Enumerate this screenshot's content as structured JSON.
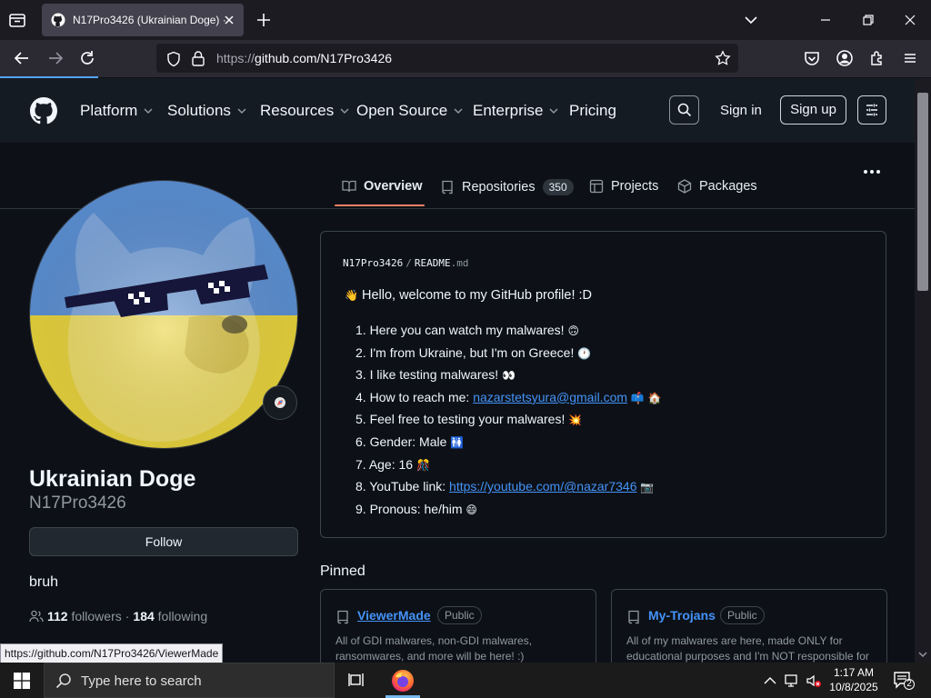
{
  "browser": {
    "tab_title": "N17Pro3426 (Ukrainian Doge) ·",
    "url_protocol": "https://",
    "url_rest": "github.com/N17Pro3426",
    "status_url": "https://github.com/N17Pro3426/ViewerMade"
  },
  "github_header": {
    "nav": [
      {
        "label": "Platform",
        "has_menu": true
      },
      {
        "label": "Solutions",
        "has_menu": true
      },
      {
        "label": "Resources",
        "has_menu": true
      },
      {
        "label": "Open Source",
        "has_menu": true
      },
      {
        "label": "Enterprise",
        "has_menu": true
      },
      {
        "label": "Pricing",
        "has_menu": false
      }
    ],
    "sign_in": "Sign in",
    "sign_up": "Sign up"
  },
  "profile_tabs": {
    "overview": "Overview",
    "repositories": "Repositories",
    "repositories_count": "350",
    "projects": "Projects",
    "packages": "Packages"
  },
  "profile": {
    "full_name": "Ukrainian Doge",
    "username": "N17Pro3426",
    "follow_label": "Follow",
    "bio": "bruh",
    "followers_count": "112",
    "followers_label": "followers",
    "separator": "·",
    "following_count": "184",
    "following_label": "following"
  },
  "readme": {
    "path_user": "N17Pro3426",
    "path_sep": "/",
    "path_file": "README",
    "path_ext": ".md",
    "greeting_emoji": "👋",
    "greeting": "Hello, welcome to my GitHub profile! :D",
    "items": [
      {
        "n": "1.",
        "text": "Here you can watch my malwares!",
        "emoji": "🙃"
      },
      {
        "n": "2.",
        "text": "I'm from Ukraine, but I'm on Greece!",
        "emoji": "🕐"
      },
      {
        "n": "3.",
        "text": "I like testing malwares!",
        "emoji": "👀"
      },
      {
        "n": "4.",
        "text": "How to reach me: ",
        "link": "nazarstetsyura@gmail.com",
        "emoji": "📫 🏠"
      },
      {
        "n": "5.",
        "text": "Feel free to testing your malwares!",
        "emoji": "💥"
      },
      {
        "n": "6.",
        "text": "Gender: Male",
        "emoji": "🚻"
      },
      {
        "n": "7.",
        "text": "Age: 16",
        "emoji": "🎊"
      },
      {
        "n": "8.",
        "text": "YouTube link: ",
        "link": "https://youtube.com/@nazar7346",
        "emoji": "📷"
      },
      {
        "n": "9.",
        "text": "Pronous: he/him",
        "emoji": "😄"
      }
    ]
  },
  "pinned": {
    "title": "Pinned",
    "cards": [
      {
        "name": "ViewerMade",
        "visibility": "Public",
        "description": "All of GDI malwares, non-GDI malwares, ransomwares, and more will be here! :)"
      },
      {
        "name": "My-Trojans",
        "visibility": "Public",
        "description": "All of my malwares are here, made ONLY for educational purposes and I'm NOT responsible for"
      }
    ]
  },
  "taskbar": {
    "search_placeholder": "Type here to search",
    "time": "1:17 AM",
    "date": "10/8/2025",
    "notification_count": "2"
  },
  "colors": {
    "accent_link": "#4493f8",
    "tab_underline": "#f78166",
    "avatar_blue": "#5b8fd3",
    "avatar_yellow": "#e8d33a"
  }
}
